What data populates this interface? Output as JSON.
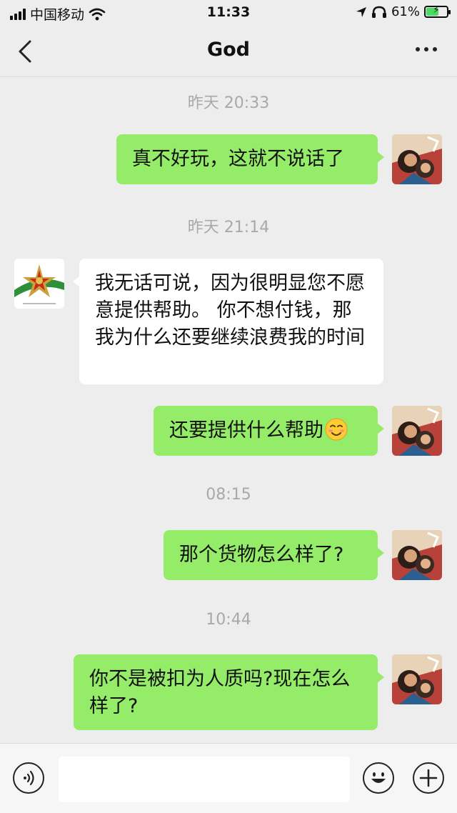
{
  "status_bar": {
    "carrier": "中国移动",
    "time": "11:33",
    "battery_percent": "61%",
    "battery_level": 0.61,
    "icons": [
      "signal-icon",
      "wifi-icon",
      "location-icon",
      "headphones-icon",
      "battery-charging-icon"
    ]
  },
  "nav": {
    "title": "God",
    "back_icon": "chevron-left-icon",
    "more_icon": "more-dots-icon"
  },
  "messages": [
    {
      "type": "timestamp",
      "text": "昨天 20:33"
    },
    {
      "type": "message",
      "sender": "me",
      "text": "真不好玩，这就不说话了"
    },
    {
      "type": "timestamp",
      "text": "昨天 21:14"
    },
    {
      "type": "message",
      "sender": "them",
      "text": "我无话可说，因为很明显您不愿意提供帮助。 你不想付钱，那我为什么还要继续浪费我的时间"
    },
    {
      "type": "message",
      "sender": "me",
      "text": "还要提供什么帮助",
      "emoji": "smiling-face-emoji"
    },
    {
      "type": "timestamp",
      "text": "08:15"
    },
    {
      "type": "message",
      "sender": "me",
      "text": "那个货物怎么样了?"
    },
    {
      "type": "timestamp",
      "text": "10:44"
    },
    {
      "type": "message",
      "sender": "me",
      "text": "你不是被扣为人质吗?现在怎么样了?"
    }
  ],
  "input_bar": {
    "voice_icon": "voice-icon",
    "text_value": "",
    "emoji_icon": "emoji-icon",
    "plus_icon": "plus-icon"
  },
  "colors": {
    "background": "#ededed",
    "my_bubble": "#95ec69",
    "their_bubble": "#ffffff",
    "timestamp": "#a9a9a9"
  }
}
